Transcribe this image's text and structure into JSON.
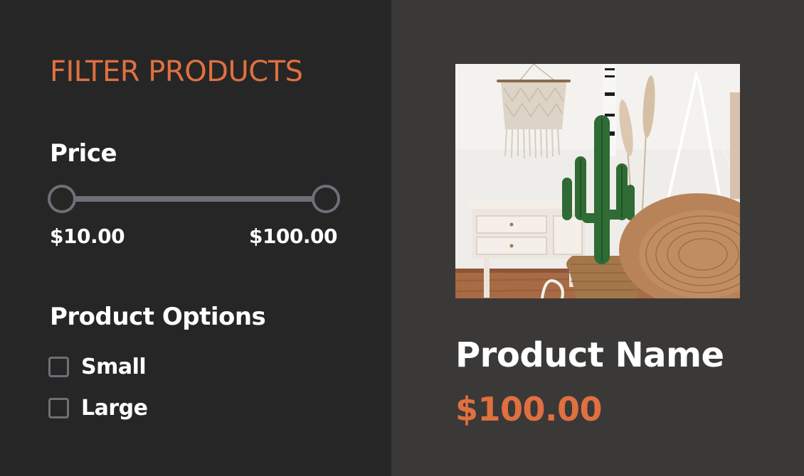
{
  "filter_panel": {
    "title": "FILTER PRODUCTS",
    "price": {
      "heading": "Price",
      "min_label": "$10.00",
      "max_label": "$100.00",
      "range_min": 10,
      "range_max": 100,
      "selected_min": 10,
      "selected_max": 100
    },
    "options": {
      "heading": "Product Options",
      "items": [
        {
          "label": "Small",
          "checked": false
        },
        {
          "label": "Large",
          "checked": false
        }
      ]
    }
  },
  "product": {
    "name": "Product Name",
    "price": "$100.00",
    "image": "product-photo"
  },
  "colors": {
    "sidebar_bg": "#262626",
    "main_bg": "#3a3938",
    "accent": "#e07040",
    "control_gray": "#6e6f77",
    "text": "#ffffff"
  }
}
